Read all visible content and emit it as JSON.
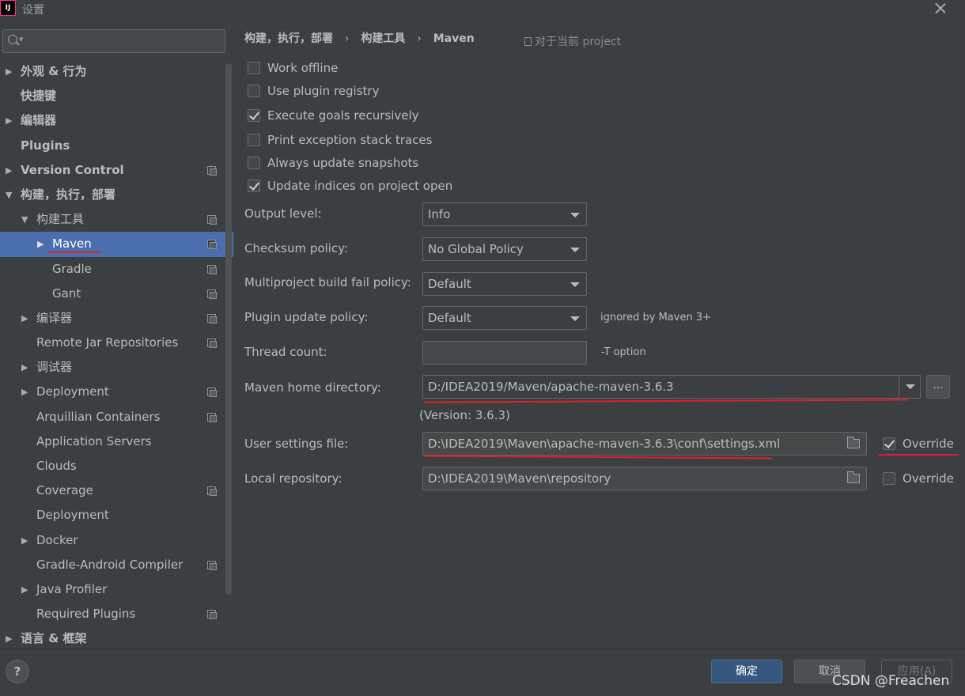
{
  "window": {
    "logo_text": "IJ",
    "title": "设置"
  },
  "search": {
    "value": "",
    "placeholder": ""
  },
  "sidebar": {
    "items": [
      {
        "label": "外观 & 行为",
        "arrow": "▶",
        "bold": true
      },
      {
        "label": "快捷键",
        "arrow": "",
        "bold": true
      },
      {
        "label": "编辑器",
        "arrow": "▶",
        "bold": true
      },
      {
        "label": "Plugins",
        "arrow": "",
        "bold": true
      },
      {
        "label": "Version Control",
        "arrow": "▶",
        "bold": true
      },
      {
        "label": "构建，执行，部署",
        "arrow": "▼",
        "bold": true
      },
      {
        "label": "构建工具",
        "arrow": "▼",
        "bold": false
      },
      {
        "label": "Maven",
        "arrow": "▶",
        "bold": false,
        "selected": true
      },
      {
        "label": "Gradle",
        "arrow": "",
        "bold": false
      },
      {
        "label": "Gant",
        "arrow": "",
        "bold": false
      },
      {
        "label": "编译器",
        "arrow": "▶",
        "bold": false
      },
      {
        "label": "Remote Jar Repositories",
        "arrow": "",
        "bold": false
      },
      {
        "label": "调试器",
        "arrow": "▶",
        "bold": false
      },
      {
        "label": "Deployment",
        "arrow": "▶",
        "bold": false
      },
      {
        "label": "Arquillian Containers",
        "arrow": "",
        "bold": false
      },
      {
        "label": "Application Servers",
        "arrow": "",
        "bold": false
      },
      {
        "label": "Clouds",
        "arrow": "",
        "bold": false
      },
      {
        "label": "Coverage",
        "arrow": "",
        "bold": false
      },
      {
        "label": "Deployment",
        "arrow": "",
        "bold": false
      },
      {
        "label": "Docker",
        "arrow": "▶",
        "bold": false
      },
      {
        "label": "Gradle-Android Compiler",
        "arrow": "",
        "bold": false
      },
      {
        "label": "Java Profiler",
        "arrow": "▶",
        "bold": false
      },
      {
        "label": "Required Plugins",
        "arrow": "",
        "bold": false
      },
      {
        "label": "语言 & 框架",
        "arrow": "▶",
        "bold": true
      }
    ]
  },
  "breadcrumb": {
    "items": [
      "构建，执行，部署",
      "构建工具",
      "Maven"
    ],
    "separator": "›"
  },
  "scope_note": "对于当前 project",
  "checkboxes": [
    {
      "label": "Work offline",
      "checked": false
    },
    {
      "label": "Use plugin registry",
      "checked": false
    },
    {
      "label": "Execute goals recursively",
      "checked": true
    },
    {
      "label": "Print exception stack traces",
      "checked": false
    },
    {
      "label": "Always update snapshots",
      "checked": false
    },
    {
      "label": "Update indices on project open",
      "checked": true
    }
  ],
  "form": {
    "output_level": {
      "label": "Output level:",
      "value": "Info"
    },
    "checksum_policy": {
      "label": "Checksum policy:",
      "value": "No Global Policy"
    },
    "fail_policy": {
      "label": "Multiproject build fail policy:",
      "value": "Default"
    },
    "plugin_update": {
      "label": "Plugin update policy:",
      "value": "Default",
      "hint": "ignored by Maven 3+"
    },
    "thread_count": {
      "label": "Thread count:",
      "value": "",
      "hint": "-T option"
    },
    "maven_home": {
      "label": "Maven home directory:",
      "value": "D:/IDEA2019/Maven/apache-maven-3.6.3",
      "version": "(Version: 3.6.3)",
      "browse_label": "..."
    },
    "user_settings": {
      "label": "User settings file:",
      "value": "D:\\IDEA2019\\Maven\\apache-maven-3.6.3\\conf\\settings.xml",
      "override_label": "Override",
      "override_checked": true
    },
    "local_repo": {
      "label": "Local repository:",
      "value": "D:\\IDEA2019\\Maven\\repository",
      "override_label": "Override",
      "override_checked": false
    }
  },
  "buttons": {
    "help": "?",
    "ok": "确定",
    "cancel": "取消",
    "apply": "应用(A)"
  },
  "watermark": "CSDN @Freachen",
  "colors": {
    "background": "#3c3f41",
    "selection": "#4b6eaf",
    "primary_button": "#365880",
    "annotation_red": "#e0202a"
  }
}
